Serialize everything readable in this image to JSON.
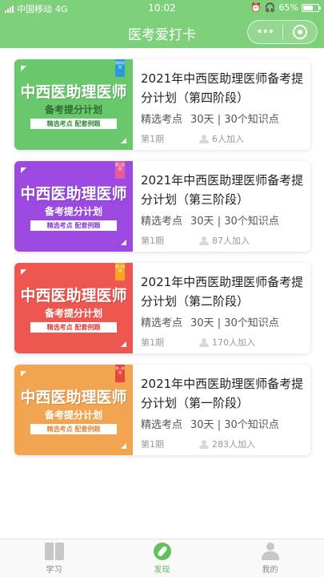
{
  "status_bar": {
    "carrier": "中国移动",
    "network": "4G",
    "time": "10:02",
    "battery_percent": "65%",
    "battery_level": 0.65
  },
  "nav": {
    "title": "医考爱打卡",
    "more_glyph": "•••",
    "more_icon": "more-dots-icon",
    "close_icon": "ring-close-icon"
  },
  "plans": [
    {
      "cover": {
        "tag": "第四阶段",
        "headline": "中西医助理医师",
        "subtitle": "备考提分计划",
        "strip": "精选考点 配套例题",
        "bg": "#69c86c",
        "sub_color": "#2f6b33",
        "strip_color": "#3a8a3e",
        "tag_color": "#2a9bd8"
      },
      "title": "2021年中西医助理医师备考提分计划（第四阶段）",
      "type": "精选考点",
      "days": "30天",
      "points": "30个知识点",
      "period": "第1期",
      "joined": "6人加入"
    },
    {
      "cover": {
        "tag": "第三阶段",
        "headline": "中西医助理医师",
        "subtitle": "备考提分计划",
        "strip": "精选考点 配套例题",
        "bg": "#9b49e0",
        "sub_color": "#ffffff",
        "strip_color": "#8a3fcc",
        "tag_color": "#e85a9b"
      },
      "title": "2021年中西医助理医师备考提分计划（第三阶段）",
      "type": "精选考点",
      "days": "30天",
      "points": "30个知识点",
      "period": "第1期",
      "joined": "87人加入"
    },
    {
      "cover": {
        "tag": "第二阶段",
        "headline": "中西医助理医师",
        "subtitle": "备考提分计划",
        "strip": "精选考点 配套例题",
        "bg": "#ee5650",
        "sub_color": "#ffffff",
        "strip_color": "#d8433e",
        "tag_color": "#f5a623"
      },
      "title": "2021年中西医助理医师备考提分计划（第二阶段）",
      "type": "精选考点",
      "days": "30天",
      "points": "30个知识点",
      "period": "第1期",
      "joined": "170人加入"
    },
    {
      "cover": {
        "tag": "第一阶段",
        "headline": "中西医助理医师",
        "subtitle": "备考提分计划",
        "strip": "精选考点 配套例题",
        "bg": "#f2a451",
        "sub_color": "#ffffff",
        "strip_color": "#e0893a",
        "tag_color": "#e8453c"
      },
      "title": "2021年中西医助理医师备考提分计划（第一阶段）",
      "type": "精选考点",
      "days": "30天",
      "points": "30个知识点",
      "period": "第1期",
      "joined": "283人加入"
    }
  ],
  "tabs": [
    {
      "label": "学习",
      "icon": "book-icon",
      "active": false
    },
    {
      "label": "发现",
      "icon": "compass-icon",
      "active": true
    },
    {
      "label": "我的",
      "icon": "user-icon",
      "active": false
    }
  ],
  "colors": {
    "nav_bg": "#7fd07a",
    "active_tab": "#5cb85c"
  }
}
